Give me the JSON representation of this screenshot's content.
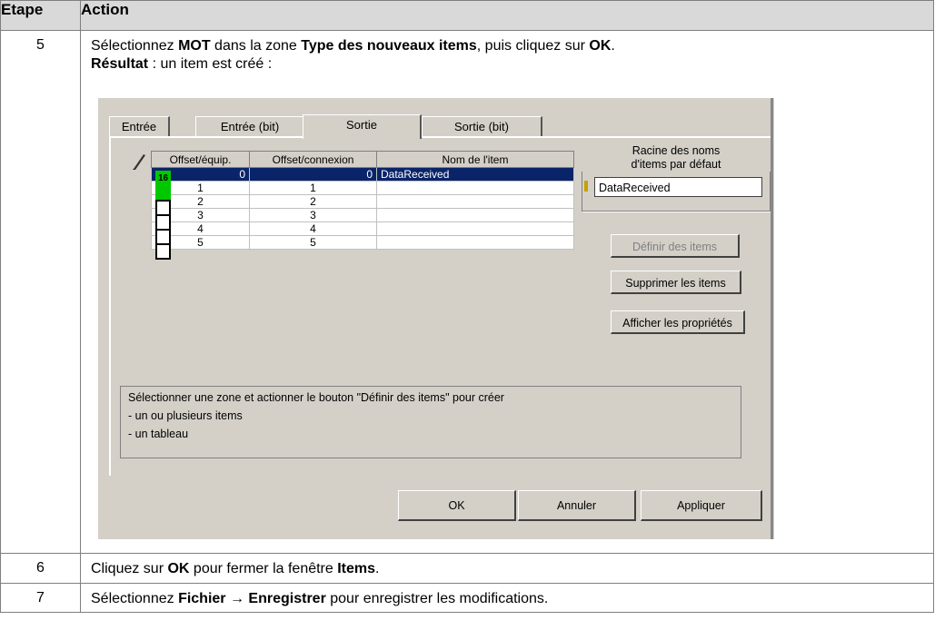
{
  "table": {
    "header_step": "Etape",
    "header_action": "Action",
    "rows": [
      {
        "step": "5",
        "line1_a": "Sélectionnez ",
        "line1_b": "MOT",
        "line1_c": " dans la zone ",
        "line1_d": "Type des nouveaux items",
        "line1_e": ", puis cliquez sur ",
        "line1_f": "OK",
        "line1_g": ".",
        "line2_a": "Résultat",
        "line2_b": " : un item est créé :"
      },
      {
        "step": "6",
        "a": "Cliquez sur ",
        "b": "OK",
        "c": " pour fermer la fenêtre ",
        "d": "Items",
        "e": "."
      },
      {
        "step": "7",
        "a": "Sélectionnez ",
        "b": "Fichier",
        "c": " → ",
        "d": "Enregistrer",
        "e": " pour enregistrer les modifications."
      }
    ]
  },
  "dialog": {
    "tabs": [
      "Entrée",
      "Entrée (bit)",
      "Sortie",
      "Sortie (bit)"
    ],
    "active_tab": "Sortie",
    "columns": [
      "Offset/équip.",
      "Offset/connexion",
      "Nom de l'item"
    ],
    "rows": [
      {
        "offset_equip": "0",
        "offset_conn": "0",
        "name": "DataReceived",
        "selected": true,
        "badge": "16"
      },
      {
        "offset_equip": "1",
        "offset_conn": "1",
        "name": ""
      },
      {
        "offset_equip": "2",
        "offset_conn": "2",
        "name": ""
      },
      {
        "offset_equip": "3",
        "offset_conn": "3",
        "name": ""
      },
      {
        "offset_equip": "4",
        "offset_conn": "4",
        "name": ""
      },
      {
        "offset_equip": "5",
        "offset_conn": "5",
        "name": ""
      }
    ],
    "root_group_title_1": "Racine des noms",
    "root_group_title_2": "d'items par défaut",
    "root_value": "DataReceived",
    "btn_define": "Définir des items",
    "btn_delete": "Supprimer les items",
    "btn_props": "Afficher les propriétés",
    "msg_1": "Sélectionner une zone et actionner le bouton \"Définir des items\" pour créer",
    "msg_2": "- un ou plusieurs items",
    "msg_3": "- un tableau",
    "btn_ok": "OK",
    "btn_cancel": "Annuler",
    "btn_apply": "Appliquer",
    "colors": {
      "selection": "#0a246a",
      "dialog_bg": "#d4d0c8",
      "green": "#00c800"
    },
    "icons": [
      "pencil-icon",
      "warning-icon"
    ]
  }
}
